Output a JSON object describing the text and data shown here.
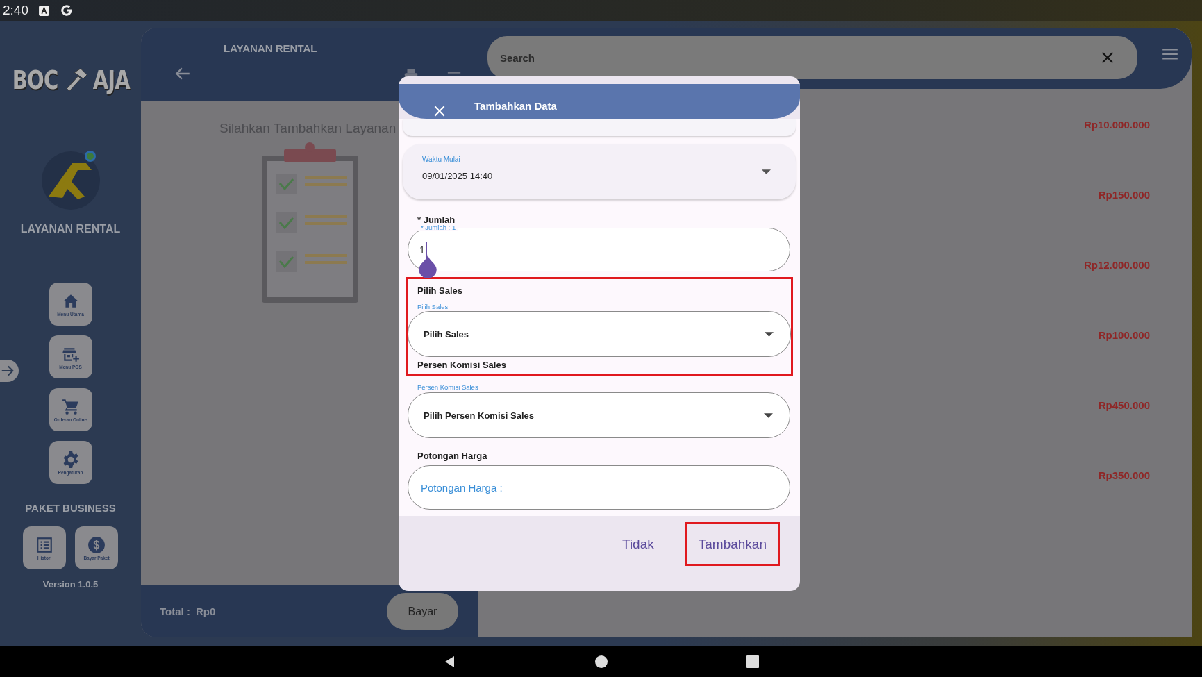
{
  "status_bar": {
    "time": "2:40"
  },
  "sidebar": {
    "logo": {
      "left": "BOC",
      "right": "AJA"
    },
    "app_name": "LAYANAN RENTAL",
    "menu": [
      {
        "label": "Menu Utama",
        "kind": "home"
      },
      {
        "label": "Menu POS",
        "kind": "store"
      },
      {
        "label": "Orderan Online",
        "kind": "cart"
      },
      {
        "label": "Pengaturan",
        "kind": "gear"
      }
    ],
    "package_title": "PAKET BUSINESS",
    "package_buttons": [
      {
        "label": "Histori",
        "kind": "list"
      },
      {
        "label": "Bayar Paket",
        "kind": "dollar"
      }
    ],
    "version": "Version 1.0.5"
  },
  "cart_panel": {
    "title": "LAYANAN RENTAL",
    "empty_message": "Silahkan Tambahkan Layanan",
    "total_label": "Total :",
    "total_value": "Rp0",
    "pay_button": "Bayar"
  },
  "catalog": {
    "search": {
      "placeholder": "Search"
    },
    "prices": [
      "Rp10.000.000",
      "Rp150.000",
      "Rp12.000.000",
      "Rp100.000",
      "Rp450.000",
      "Rp350.000"
    ]
  },
  "dialog": {
    "title": "Tambahkan Data",
    "start_time": {
      "label": "Waktu Mulai",
      "value": "09/01/2025 14:40"
    },
    "quantity": {
      "heading": "* Jumlah",
      "floating_label": "* Jumlah : 1",
      "value": "1"
    },
    "sales": {
      "heading": "Pilih Sales",
      "floating_label": "Pilih Sales",
      "value": "Pilih Sales",
      "highlighted": true
    },
    "commission": {
      "heading": "Persen Komisi Sales",
      "floating_label": "Persen Komisi Sales",
      "value": "Pilih Persen Komisi Sales"
    },
    "discount": {
      "heading": "Potongan Harga",
      "placeholder": "Potongan Harga :"
    },
    "buttons": [
      {
        "label": "Tidak",
        "highlighted": false
      },
      {
        "label": "Tambahkan",
        "highlighted": true
      }
    ]
  }
}
